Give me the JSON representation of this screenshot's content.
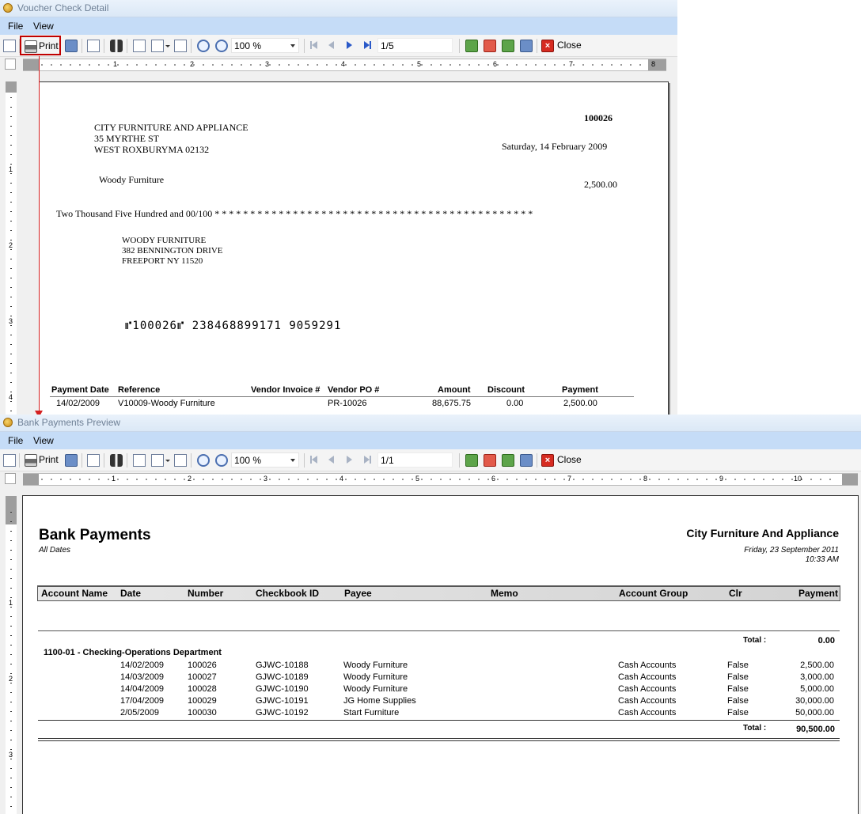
{
  "voucher_window": {
    "title": "Voucher Check Detail",
    "menu": [
      "File",
      "View"
    ],
    "toolbar": {
      "print_label": "Print",
      "zoom": "100 %",
      "page": "1/5",
      "close_label": "Close"
    },
    "ruler_numbers": [
      "1",
      "2",
      "3",
      "4",
      "5",
      "6",
      "7",
      "8"
    ],
    "vruler_numbers": [
      "1",
      "2",
      "3",
      "4"
    ],
    "check": {
      "number": "100026",
      "company_lines": [
        "CITY FURNITURE AND APPLIANCE",
        "35 MYRTHE ST",
        "WEST ROXBURYMA 02132"
      ],
      "date": "Saturday, 14 February 2009",
      "payee": "Woody Furniture",
      "amount": "2,500.00",
      "amount_words": "Two Thousand Five Hundred and 00/100 * * * * * * * * * * * * * * * * * * * * * * * * * * * * * * * * * * * * * * * * * * * * *",
      "address_lines": [
        "WOODY FURNITURE",
        "382 BENNINGTON DRIVE",
        "FREEPORT NY 11520"
      ],
      "micr": "⑈100026⑈ 238468899171 9059291",
      "detail_headers": {
        "payment_date": "Payment Date",
        "reference": "Reference",
        "vendor_invoice": "Vendor Invoice #",
        "vendor_po": "Vendor PO #",
        "amount": "Amount",
        "discount": "Discount",
        "payment": "Payment"
      },
      "detail_row": {
        "payment_date": "14/02/2009",
        "reference": "V10009-Woody Furniture",
        "vendor_invoice": "",
        "vendor_po": "PR-10026",
        "amount": "88,675.75",
        "discount": "0.00",
        "payment": "2,500.00"
      }
    }
  },
  "bank_window": {
    "title": "Bank Payments Preview",
    "menu": [
      "File",
      "View"
    ],
    "toolbar": {
      "print_label": "Print",
      "zoom": "100 %",
      "page": "1/1",
      "close_label": "Close"
    },
    "ruler_numbers": [
      "1",
      "2",
      "3",
      "4",
      "5",
      "6",
      "7",
      "8",
      "9",
      "10"
    ],
    "vruler_numbers": [
      "1",
      "2",
      "3"
    ],
    "report": {
      "title": "Bank Payments",
      "subtitle": "All Dates",
      "company": "City Furniture And Appliance",
      "date": "Friday, 23 September 2011",
      "time": "10:33 AM",
      "headers": {
        "account_name": "Account Name",
        "date": "Date",
        "number": "Number",
        "checkbook_id": "Checkbook ID",
        "payee": "Payee",
        "memo": "Memo",
        "account_group": "Account Group",
        "clr": "Clr",
        "payment": "Payment"
      },
      "first_total_label": "Total :",
      "first_total_value": "0.00",
      "group_name": "1100-01 - Checking-Operations Department",
      "rows": [
        {
          "date": "14/02/2009",
          "number": "100026",
          "checkbook": "GJWC-10188",
          "payee": "Woody Furniture",
          "group": "Cash Accounts",
          "clr": "False",
          "payment": "2,500.00"
        },
        {
          "date": "14/03/2009",
          "number": "100027",
          "checkbook": "GJWC-10189",
          "payee": "Woody Furniture",
          "group": "Cash Accounts",
          "clr": "False",
          "payment": "3,000.00"
        },
        {
          "date": "14/04/2009",
          "number": "100028",
          "checkbook": "GJWC-10190",
          "payee": "Woody Furniture",
          "group": "Cash Accounts",
          "clr": "False",
          "payment": "5,000.00"
        },
        {
          "date": "17/04/2009",
          "number": "100029",
          "checkbook": "GJWC-10191",
          "payee": "JG Home Supplies",
          "group": "Cash Accounts",
          "clr": "False",
          "payment": "30,000.00"
        },
        {
          "date": "2/05/2009",
          "number": "100030",
          "checkbook": "GJWC-10192",
          "payee": "Start Furniture",
          "group": "Cash Accounts",
          "clr": "False",
          "payment": "50,000.00"
        }
      ],
      "total_label": "Total :",
      "total_value": "90,500.00"
    }
  },
  "colors": {
    "menubar": "#c5dcf7",
    "highlight": "#c00000",
    "arrow": "#d42020"
  }
}
